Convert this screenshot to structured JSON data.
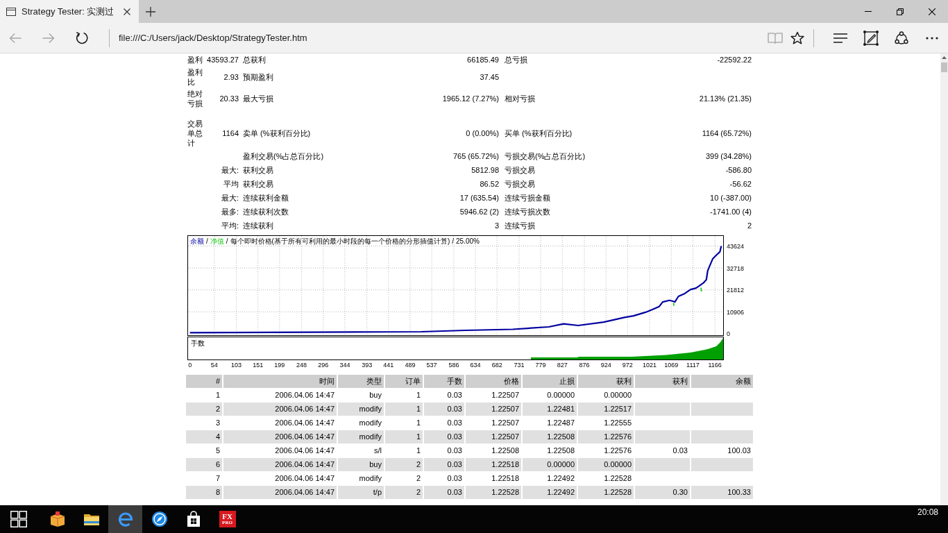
{
  "browser": {
    "tab": {
      "title": "Strategy Tester: 实测过",
      "selected": true
    },
    "nav_buttons": [
      {
        "kind": "back",
        "disabled": true
      },
      {
        "kind": "forward",
        "disabled": true
      },
      {
        "kind": "refresh",
        "disabled": false
      }
    ],
    "address": "file:///C:/Users/jack/Desktop/StrategyTester.htm",
    "tools": [
      {
        "kind": "reading-view",
        "disabled": true
      },
      {
        "kind": "favorite",
        "disabled": false
      },
      {
        "kind": "hub",
        "disabled": false
      },
      {
        "kind": "web-note",
        "disabled": false
      },
      {
        "kind": "share",
        "disabled": false
      },
      {
        "kind": "more",
        "disabled": false
      }
    ]
  },
  "report": {
    "summary": [
      {
        "label": "盈利",
        "value": "43593.27",
        "pairs": [
          {
            "label": "总获利",
            "value": "66185.49"
          },
          {
            "label": "总亏损",
            "value": "-22592.22"
          }
        ]
      },
      {
        "label": "盈利比",
        "value": "2.93",
        "pairs": [
          {
            "label": "预期盈利",
            "value": "37.45"
          }
        ]
      },
      {
        "label": "绝对亏损",
        "value": "20.33",
        "pairs": [
          {
            "label": "最大亏损",
            "value": "1965.12 (7.27%)"
          },
          {
            "label": "相对亏损",
            "value": "21.13% (21.35)"
          }
        ]
      },
      {
        "label": "交易单总计",
        "value": "1164",
        "pairs": [
          {
            "label": "卖单 (%获利百分比)",
            "value": "0 (0.00%)"
          },
          {
            "label": "买单 (%获利百分比)",
            "value": "1164 (65.72%)"
          }
        ]
      },
      {
        "pairs": [
          {
            "label": "盈利交易(%占总百分比)",
            "value": "765 (65.72%)"
          },
          {
            "label": "亏损交易(%占总百分比)",
            "value": "399 (34.28%)"
          }
        ]
      },
      {
        "qualifier": "最大:",
        "pairs": [
          {
            "label": "获利交易",
            "value": "5812.98"
          },
          {
            "label": "亏损交易",
            "value": "-586.80"
          }
        ]
      },
      {
        "qualifier": "平均",
        "pairs": [
          {
            "label": "获利交易",
            "value": "86.52"
          },
          {
            "label": "亏损交易",
            "value": "-56.62"
          }
        ]
      },
      {
        "qualifier": "最大:",
        "pairs": [
          {
            "label": "连续获利金额",
            "value": "17 (635.54)"
          },
          {
            "label": "连续亏损金额",
            "value": "10 (-387.00)"
          }
        ]
      },
      {
        "qualifier": "最多:",
        "pairs": [
          {
            "label": "连续获利次数",
            "value": "5946.62 (2)"
          },
          {
            "label": "连续亏损次数",
            "value": "-1741.00 (4)"
          }
        ]
      },
      {
        "qualifier": "平均:",
        "pairs": [
          {
            "label": "连续获利",
            "value": "3"
          },
          {
            "label": "连续亏损",
            "value": "2"
          }
        ]
      }
    ],
    "chart": {
      "legend_separator": "/",
      "legend_note": "每个即时价格(基于所有可利用的最小时段的每一个价格的分形插值计算)",
      "legend_ratio": "25.00%",
      "chart_data": {
        "type": "line",
        "x": [
          0,
          514,
          611,
          717,
          797,
          830,
          862,
          919,
          965,
          985,
          1012,
          1027,
          1042,
          1050,
          1065,
          1074,
          1075,
          1077,
          1085,
          1099,
          1112,
          1124,
          1135,
          1136,
          1140,
          1147,
          1150,
          1161,
          1170,
          1175,
          1176,
          1177,
          1180
        ],
        "series": [
          {
            "name": "余额",
            "color": "#0000a0",
            "values": [
              500,
              1000,
              1700,
              2200,
              3400,
              4900,
              4100,
              5800,
              8100,
              8900,
              10700,
              12000,
              13500,
              15800,
              16600,
              16100,
              16000,
              15800,
              18600,
              20000,
              22000,
              22700,
              24400,
              24600,
              25200,
              26900,
              31400,
              37200,
              39300,
              40300,
              40500,
              40700,
              43600
            ]
          },
          {
            "name": "净值",
            "color": "#22cc22",
            "values": [
              null,
              null,
              null,
              null,
              null,
              null,
              null,
              null,
              null,
              null,
              null,
              null,
              null,
              null,
              null,
              15400,
              13900,
              null,
              null,
              null,
              null,
              null,
              22900,
              21000,
              null,
              null,
              null,
              null,
              null,
              null,
              null,
              null,
              null
            ]
          }
        ],
        "xlim": [
          -5,
          1185
        ],
        "ylim": [
          -900,
          48800
        ],
        "xticks": [
          0,
          54,
          103,
          151,
          199,
          248,
          296,
          344,
          393,
          441,
          489,
          537,
          586,
          634,
          682,
          731,
          779,
          827,
          876,
          924,
          972,
          1021,
          1069,
          1117,
          1166
        ],
        "yticks": [
          0,
          10906,
          21812,
          32718,
          43624
        ],
        "grid": true
      },
      "lower_panel": {
        "label": "手数"
      }
    },
    "trades": {
      "columns": [
        "#",
        "时间",
        "类型",
        "订单",
        "手数",
        "价格",
        "止损",
        "获利",
        "获利",
        "余额"
      ],
      "rows": [
        [
          "1",
          "2006.04.06 14:47",
          "buy",
          "1",
          "0.03",
          "1.22507",
          "0.00000",
          "0.00000"
        ],
        [
          "2",
          "2006.04.06 14:47",
          "modify",
          "1",
          "0.03",
          "1.22507",
          "1.22481",
          "1.22517"
        ],
        [
          "3",
          "2006.04.06 14:47",
          "modify",
          "1",
          "0.03",
          "1.22507",
          "1.22487",
          "1.22555"
        ],
        [
          "4",
          "2006.04.06 14:47",
          "modify",
          "1",
          "0.03",
          "1.22507",
          "1.22508",
          "1.22576"
        ],
        [
          "5",
          "2006.04.06 14:47",
          "s/l",
          "1",
          "0.03",
          "1.22508",
          "1.22508",
          "1.22576",
          "0.03",
          "100.03"
        ],
        [
          "6",
          "2006.04.06 14:47",
          "buy",
          "2",
          "0.03",
          "1.22518",
          "0.00000",
          "0.00000"
        ],
        [
          "7",
          "2006.04.06 14:47",
          "modify",
          "2",
          "0.03",
          "1.22518",
          "1.22492",
          "1.22528"
        ],
        [
          "8",
          "2006.04.06 14:47",
          "t/p",
          "2",
          "0.03",
          "1.22528",
          "1.22492",
          "1.22528",
          "0.30",
          "100.33"
        ]
      ]
    }
  },
  "taskbar": {
    "apps": [
      {
        "kind": "box",
        "selected": false
      },
      {
        "kind": "folder",
        "selected": false
      },
      {
        "kind": "browser",
        "selected": true
      },
      {
        "kind": "compass",
        "selected": false
      },
      {
        "kind": "store",
        "selected": false
      },
      {
        "kind": "fx-logo",
        "selected": false,
        "texts": [
          "FX",
          "PRO"
        ]
      }
    ],
    "clock": "20:08"
  }
}
